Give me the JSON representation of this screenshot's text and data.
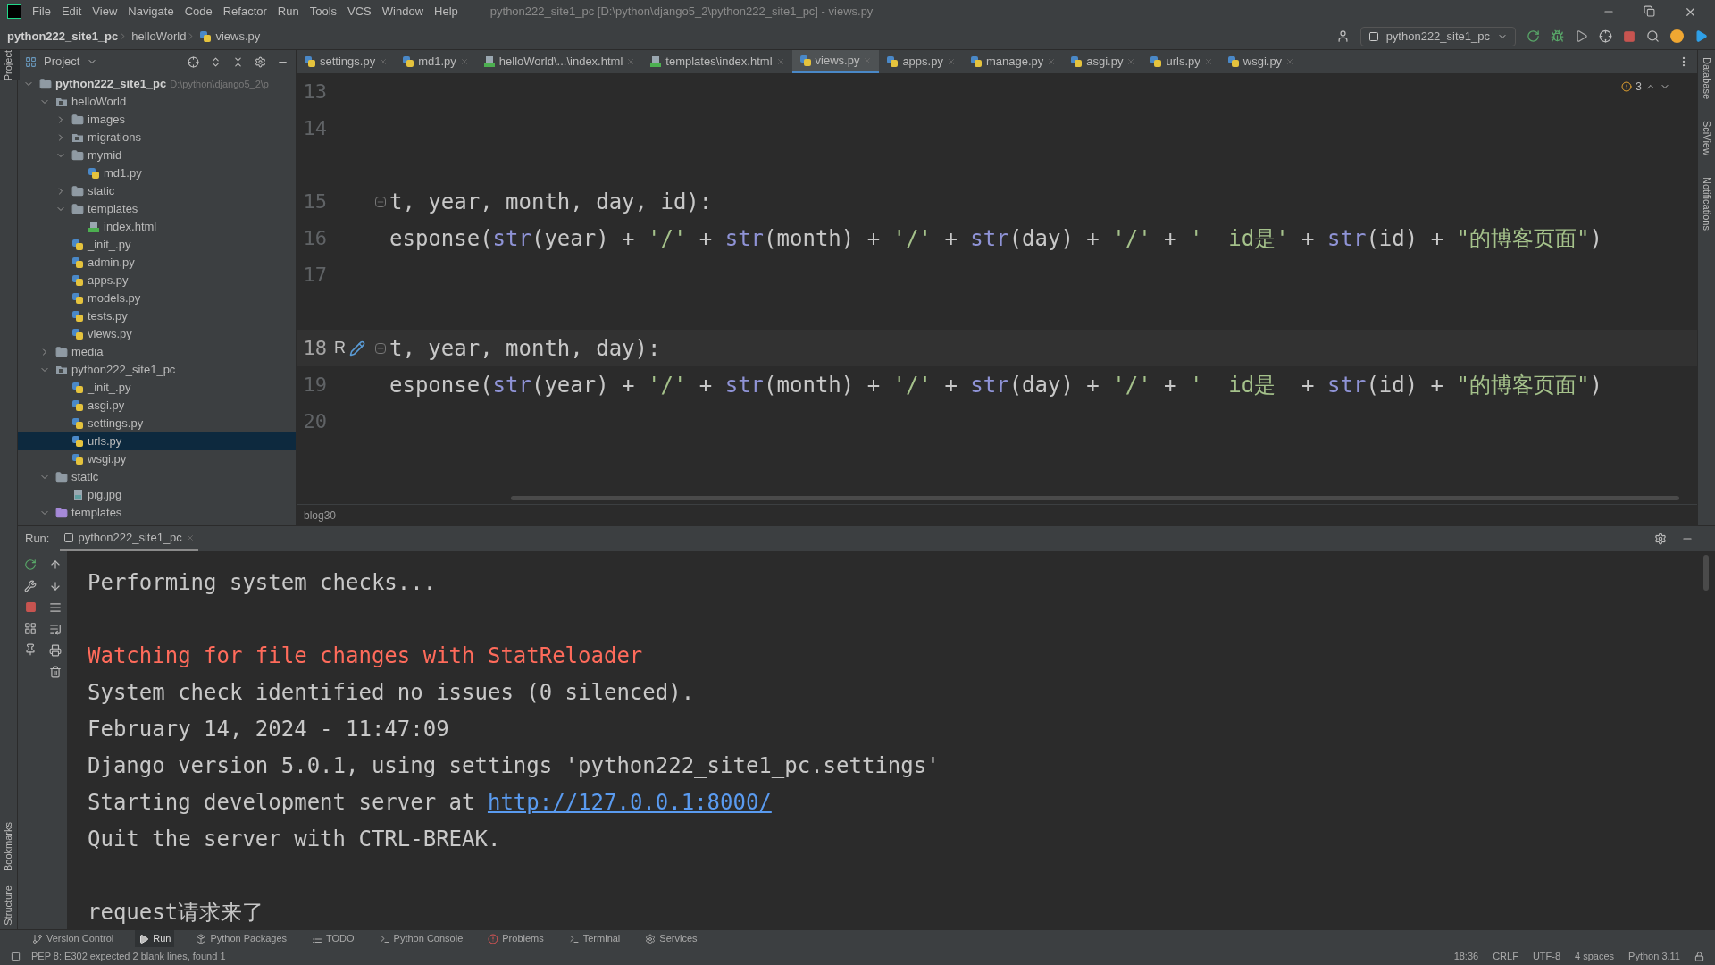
{
  "window": {
    "title": "python222_site1_pc [D:\\python\\django5_2\\python222_site1_pc] - views.py",
    "menu": [
      "File",
      "Edit",
      "View",
      "Navigate",
      "Code",
      "Refactor",
      "Run",
      "Tools",
      "VCS",
      "Window",
      "Help"
    ]
  },
  "navbar": {
    "breadcrumb": [
      {
        "label": "python222_site1_pc",
        "kind": "project"
      },
      {
        "label": "helloWorld",
        "kind": "folder"
      },
      {
        "label": "views.py",
        "kind": "python"
      }
    ],
    "run_config": "python222_site1_pc"
  },
  "left_stripe": {
    "top": [
      "Project"
    ],
    "bottom": [
      "Bookmarks",
      "Structure"
    ]
  },
  "right_stripe": [
    "Database",
    "SciView",
    "Notifications"
  ],
  "project_panel": {
    "title": "Project",
    "tree": [
      {
        "name": "python222_site1_pc",
        "kind": "root",
        "path": "D:\\python\\django5_2\\p",
        "expanded": true,
        "selected": false,
        "children": [
          {
            "name": "helloWorld",
            "kind": "module",
            "expanded": true,
            "selected": false,
            "children": [
              {
                "name": "images",
                "kind": "folder",
                "expanded": false,
                "selected": false
              },
              {
                "name": "migrations",
                "kind": "module",
                "expanded": false,
                "selected": false
              },
              {
                "name": "mymid",
                "kind": "folder",
                "expanded": true,
                "selected": false,
                "children": [
                  {
                    "name": "md1.py",
                    "kind": "python",
                    "selected": false
                  }
                ]
              },
              {
                "name": "static",
                "kind": "folder",
                "expanded": false,
                "selected": false
              },
              {
                "name": "templates",
                "kind": "folder",
                "expanded": true,
                "selected": false,
                "children": [
                  {
                    "name": "index.html",
                    "kind": "html",
                    "selected": false
                  }
                ]
              },
              {
                "name": "_init_.py",
                "kind": "python",
                "selected": false
              },
              {
                "name": "admin.py",
                "kind": "python",
                "selected": false
              },
              {
                "name": "apps.py",
                "kind": "python",
                "selected": false
              },
              {
                "name": "models.py",
                "kind": "python",
                "selected": false
              },
              {
                "name": "tests.py",
                "kind": "python",
                "selected": false
              },
              {
                "name": "views.py",
                "kind": "python",
                "selected": false
              }
            ]
          },
          {
            "name": "media",
            "kind": "folder",
            "expanded": false,
            "selected": false
          },
          {
            "name": "python222_site1_pc",
            "kind": "module",
            "expanded": true,
            "selected": false,
            "children": [
              {
                "name": "_init_.py",
                "kind": "python",
                "selected": false
              },
              {
                "name": "asgi.py",
                "kind": "python",
                "selected": false
              },
              {
                "name": "settings.py",
                "kind": "python",
                "selected": false
              },
              {
                "name": "urls.py",
                "kind": "python",
                "selected": true
              },
              {
                "name": "wsgi.py",
                "kind": "python",
                "selected": false
              }
            ]
          },
          {
            "name": "static",
            "kind": "folder",
            "expanded": true,
            "selected": false,
            "children": [
              {
                "name": "pig.jpg",
                "kind": "image",
                "selected": false
              }
            ]
          },
          {
            "name": "templates",
            "kind": "templates",
            "expanded": true,
            "selected": false
          }
        ]
      }
    ]
  },
  "editor": {
    "tabs": [
      {
        "label": "settings.py",
        "kind": "python",
        "selected": false
      },
      {
        "label": "md1.py",
        "kind": "python",
        "selected": false
      },
      {
        "label": "helloWorld\\...\\index.html",
        "kind": "html",
        "selected": false
      },
      {
        "label": "templates\\index.html",
        "kind": "html",
        "selected": false
      },
      {
        "label": "views.py",
        "kind": "python",
        "selected": true
      },
      {
        "label": "apps.py",
        "kind": "python",
        "selected": false
      },
      {
        "label": "manage.py",
        "kind": "python",
        "selected": false
      },
      {
        "label": "asgi.py",
        "kind": "python",
        "selected": false
      },
      {
        "label": "urls.py",
        "kind": "python",
        "selected": false
      },
      {
        "label": "wsgi.py",
        "kind": "python",
        "selected": false
      }
    ],
    "inspection_count": "3",
    "lines": [
      {
        "number": "13",
        "kind": "plain",
        "current": false
      },
      {
        "number": "14",
        "kind": "plain",
        "current": false
      },
      {
        "number": "15",
        "kind": "def",
        "current": false,
        "tokens": [
          {
            "text": "t, year, month, day, id):",
            "kind": "plain"
          }
        ]
      },
      {
        "number": "16",
        "kind": "plain",
        "current": false,
        "tokens": [
          {
            "text": "esponse(",
            "kind": "plain"
          },
          {
            "text": "str",
            "kind": "builtin"
          },
          {
            "text": "(year) + ",
            "kind": "plain"
          },
          {
            "text": "'/'",
            "kind": "string"
          },
          {
            "text": " + ",
            "kind": "plain"
          },
          {
            "text": "str",
            "kind": "builtin"
          },
          {
            "text": "(month) + ",
            "kind": "plain"
          },
          {
            "text": "'/'",
            "kind": "string"
          },
          {
            "text": " + ",
            "kind": "plain"
          },
          {
            "text": "str",
            "kind": "builtin"
          },
          {
            "text": "(day) + ",
            "kind": "plain"
          },
          {
            "text": "'/'",
            "kind": "string"
          },
          {
            "text": " + ",
            "kind": "plain"
          },
          {
            "text": "'  id是'",
            "kind": "string"
          },
          {
            "text": " + ",
            "kind": "plain"
          },
          {
            "text": "str",
            "kind": "builtin"
          },
          {
            "text": "(id) + ",
            "kind": "plain"
          },
          {
            "text": "\"的博客页面\"",
            "kind": "string"
          },
          {
            "text": ")",
            "kind": "plain"
          }
        ]
      },
      {
        "number": "17",
        "kind": "plain",
        "current": false
      },
      {
        "number": "18",
        "kind": "def",
        "current": true,
        "gutter_mark": "R",
        "tokens": [
          {
            "text": "t, year, month, day):",
            "kind": "plain"
          }
        ]
      },
      {
        "number": "19",
        "kind": "plain",
        "current": false,
        "tokens": [
          {
            "text": "esponse(",
            "kind": "plain"
          },
          {
            "text": "str",
            "kind": "builtin"
          },
          {
            "text": "(year) + ",
            "kind": "plain"
          },
          {
            "text": "'/'",
            "kind": "string"
          },
          {
            "text": " + ",
            "kind": "plain"
          },
          {
            "text": "str",
            "kind": "builtin"
          },
          {
            "text": "(month) + ",
            "kind": "plain"
          },
          {
            "text": "'/'",
            "kind": "string"
          },
          {
            "text": " + ",
            "kind": "plain"
          },
          {
            "text": "str",
            "kind": "builtin"
          },
          {
            "text": "(day) + ",
            "kind": "plain"
          },
          {
            "text": "'/'",
            "kind": "string"
          },
          {
            "text": " + ",
            "kind": "plain"
          },
          {
            "text": "'  id是",
            "kind": "string"
          },
          {
            "text": "  + ",
            "kind": "plain"
          },
          {
            "text": "str",
            "kind": "builtin"
          },
          {
            "text": "(id) + ",
            "kind": "plain"
          },
          {
            "text": "\"的博客页面\"",
            "kind": "string"
          },
          {
            "text": ")",
            "kind": "plain"
          }
        ]
      },
      {
        "number": "20",
        "kind": "plain",
        "current": false
      }
    ],
    "breadcrumb": "blog30"
  },
  "run": {
    "label": "Run:",
    "tab": "python222_site1_pc",
    "console": [
      [
        {
          "text": "Performing system checks...",
          "kind": "plain"
        }
      ],
      [
        {
          "text": "Watching for file changes with StatReloader",
          "kind": "error"
        },
        {
          "text": "System check identified no issues (0 silenced).",
          "kind": "plain"
        },
        {
          "text": "February 14, 2024 - 11:47:09",
          "kind": "plain"
        },
        {
          "text": "Django version 5.0.1, using settings 'python222_site1_pc.settings'",
          "kind": "plain"
        },
        {
          "text": "Starting development server at ",
          "kind": "plain",
          "link": "http://127.0.0.1:8000/"
        },
        {
          "text": "Quit the server with CTRL-BREAK.",
          "kind": "plain"
        }
      ],
      [
        {
          "text": "request请求来了",
          "kind": "plain"
        }
      ]
    ]
  },
  "tool_windows": [
    {
      "label": "Version Control",
      "kind": "vcs",
      "selected": false
    },
    {
      "label": "Run",
      "kind": "run",
      "selected": true
    },
    {
      "label": "Python Packages",
      "kind": "packages",
      "selected": false
    },
    {
      "label": "TODO",
      "kind": "todo",
      "selected": false
    },
    {
      "label": "Python Console",
      "kind": "console",
      "selected": false
    },
    {
      "label": "Problems",
      "kind": "problems",
      "selected": false
    },
    {
      "label": "Terminal",
      "kind": "terminal",
      "selected": false
    },
    {
      "label": "Services",
      "kind": "services",
      "selected": false
    }
  ],
  "status_bar": {
    "message": "PEP 8: E302 expected 2 blank lines, found 1",
    "items": [
      "18:36",
      "CRLF",
      "UTF-8",
      "4 spaces",
      "Python 3.11"
    ]
  }
}
